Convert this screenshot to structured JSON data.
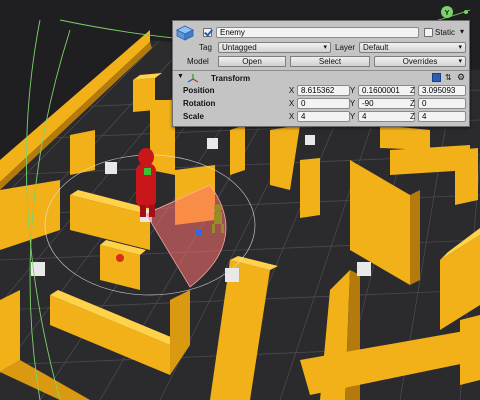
{
  "colors": {
    "wall": "#f2b118",
    "wall_shadow": "#b47a0c",
    "floor": "#2b2b2e",
    "grid": "#4a4a4f",
    "enemy": "#c8161b",
    "player": "#9a8a2a",
    "view_cone": "#ff6f6f",
    "gizmo": "#7dd36a",
    "inspector_bg": "#c4c4c4"
  },
  "inspector": {
    "object_name": "Enemy",
    "active": true,
    "static_label": "Static",
    "static_checked": false,
    "tag_label": "Tag",
    "tag_value": "Untagged",
    "layer_label": "Layer",
    "layer_value": "Default",
    "model_label": "Model",
    "open_label": "Open",
    "select_label": "Select",
    "overrides_label": "Overrides",
    "transform_title": "Transform",
    "position_label": "Position",
    "rotation_label": "Rotation",
    "scale_label": "Scale",
    "axis_x": "X",
    "axis_y": "Y",
    "axis_z": "Z",
    "position": {
      "x": "8.615362",
      "y": "0.1600001",
      "z": "3.095093"
    },
    "rotation": {
      "x": "0",
      "y": "-90",
      "z": "0"
    },
    "scale": {
      "x": "4",
      "y": "4",
      "z": "4"
    }
  },
  "scene": {
    "active_object": "Enemy",
    "view_icon": "scene-gizmo-icon"
  }
}
